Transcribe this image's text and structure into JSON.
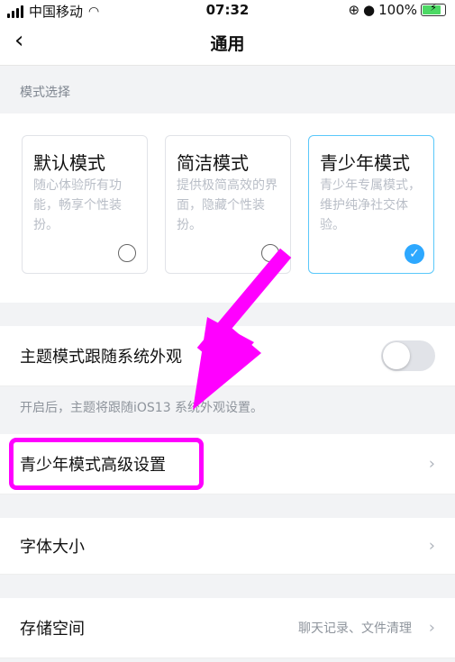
{
  "status_bar": {
    "carrier": "中国移动",
    "time": "07:32",
    "battery": "100%"
  },
  "header": {
    "title": "通用"
  },
  "mode_section": {
    "label": "模式选择",
    "cards": [
      {
        "title": "默认模式",
        "desc": "随心体验所有功能，畅享个性装扮。"
      },
      {
        "title": "简洁模式",
        "desc": "提供极简高效的界面，隐藏个性装扮。"
      },
      {
        "title": "青少年模式",
        "desc": "青少年专属模式，维护纯净社交体验。"
      }
    ]
  },
  "theme_row": {
    "label": "主题模式跟随系统外观"
  },
  "theme_helper": "开启后，主题将跟随iOS13 系统外观设置。",
  "teen_row": {
    "label": "青少年模式高级设置"
  },
  "font_row": {
    "label": "字体大小"
  },
  "storage_row": {
    "label": "存储空间",
    "value": "聊天记录、文件清理"
  },
  "colors": {
    "accent": "#2da8ff",
    "highlight": "#ff00ff"
  }
}
